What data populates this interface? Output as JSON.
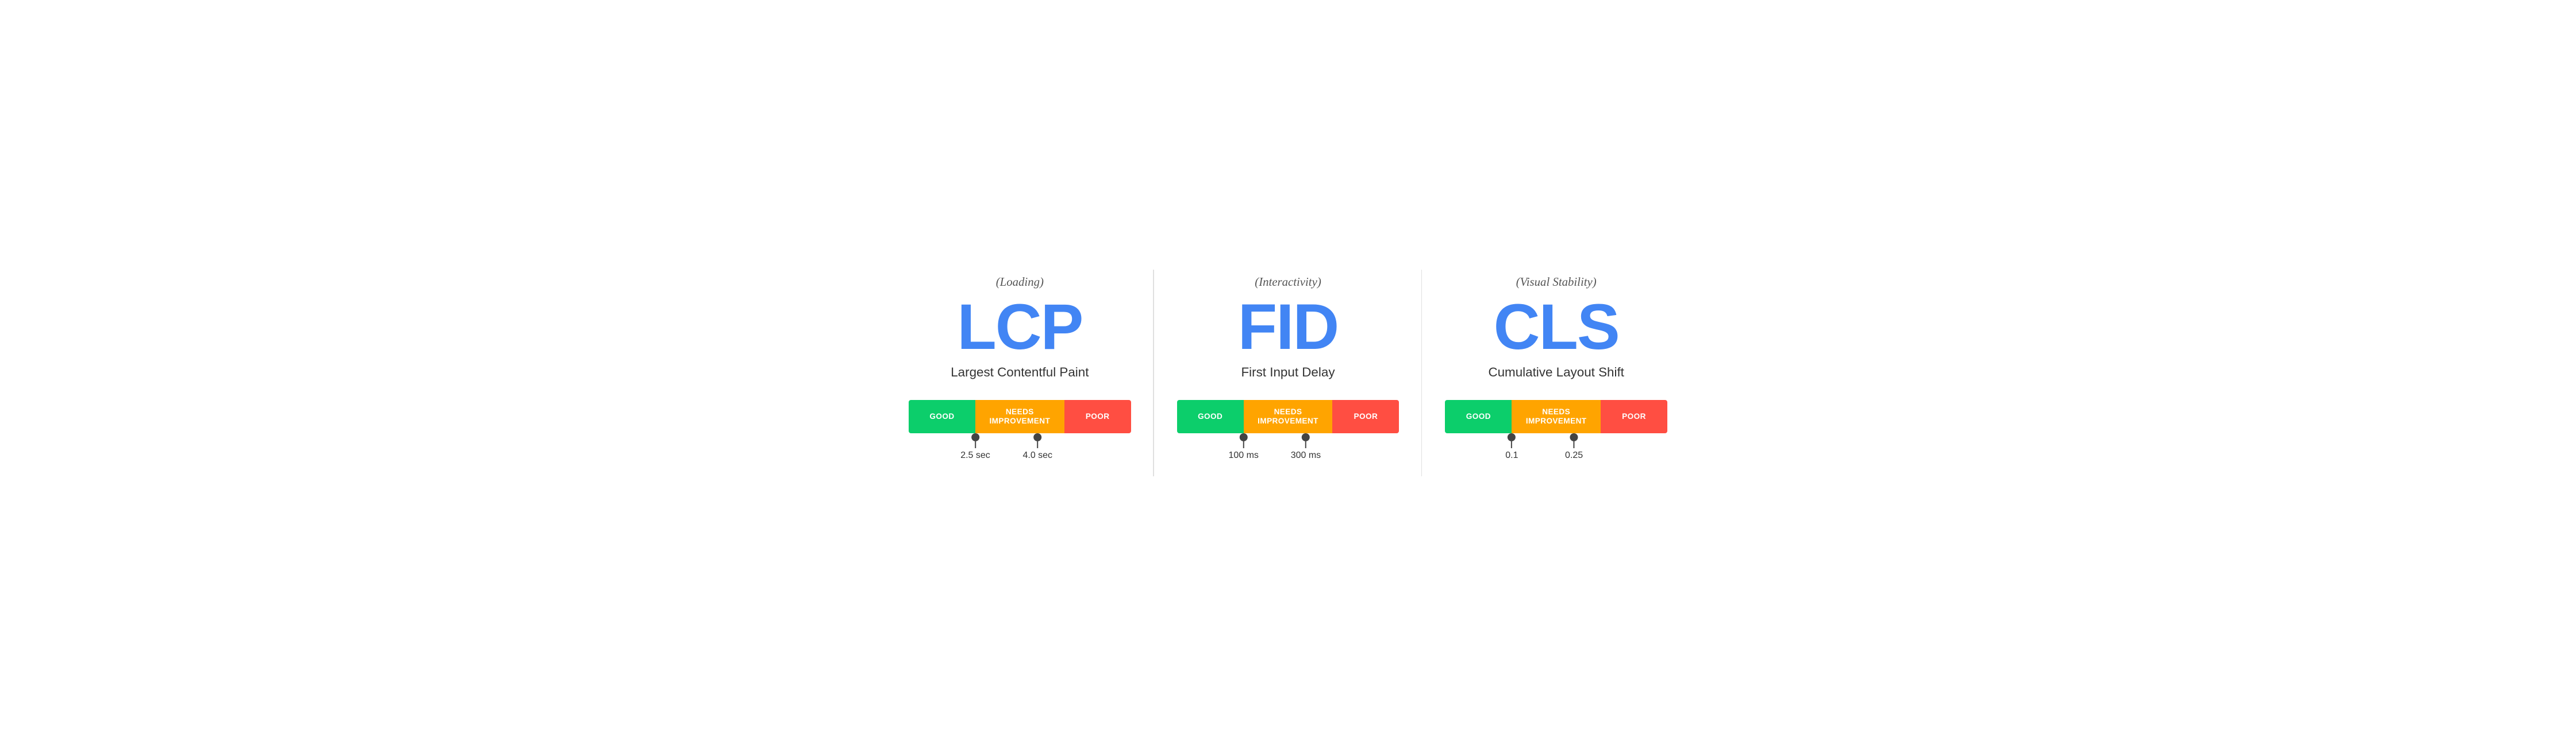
{
  "panels": [
    {
      "id": "lcp",
      "subtitle": "(Loading)",
      "acronym": "LCP",
      "name": "Largest Contentful Paint",
      "markers": [
        {
          "label": "2.5 sec",
          "position": 30
        },
        {
          "label": "4.0 sec",
          "position": 58
        }
      ]
    },
    {
      "id": "fid",
      "subtitle": "(Interactivity)",
      "acronym": "FID",
      "name": "First Input Delay",
      "markers": [
        {
          "label": "100 ms",
          "position": 30
        },
        {
          "label": "300 ms",
          "position": 58
        }
      ]
    },
    {
      "id": "cls",
      "subtitle": "(Visual Stability)",
      "acronym": "CLS",
      "name": "Cumulative Layout Shift",
      "markers": [
        {
          "label": "0.1",
          "position": 30
        },
        {
          "label": "0.25",
          "position": 58
        }
      ]
    }
  ],
  "bar_labels": {
    "good": "GOOD",
    "needs": "NEEDS IMPROVEMENT",
    "poor": "POOR"
  }
}
